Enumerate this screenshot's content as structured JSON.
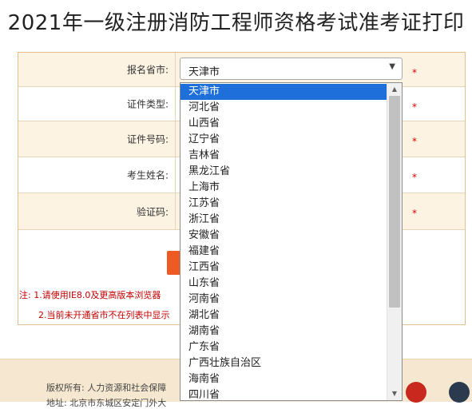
{
  "page_title": "2021年一级注册消防工程师资格考试准考证打印",
  "form": {
    "fields": [
      {
        "label": "报名省市:",
        "required": "*"
      },
      {
        "label": "证件类型:",
        "required": "*"
      },
      {
        "label": "证件号码:",
        "required": "*"
      },
      {
        "label": "考生姓名:",
        "required": "*"
      },
      {
        "label": "验证码:",
        "required": "*"
      }
    ],
    "province_select": {
      "value": "天津市"
    }
  },
  "notes": {
    "line1": "注: 1.请使用IE8.0及更高版本浏览器",
    "line2": "2.当前未开通省市不在列表中显示"
  },
  "footer": {
    "copyright": "版权所有: 人力资源和社会保障",
    "address": "地址: 北京市东城区安定门外大"
  },
  "dropdown": {
    "options": [
      "天津市",
      "河北省",
      "山西省",
      "辽宁省",
      "吉林省",
      "黑龙江省",
      "上海市",
      "江苏省",
      "浙江省",
      "安徽省",
      "福建省",
      "江西省",
      "山东省",
      "河南省",
      "湖北省",
      "湖南省",
      "广东省",
      "广西壮族自治区",
      "海南省",
      "四川省"
    ],
    "selected_index": 0
  },
  "colors": {
    "selected": "#1e6fd9",
    "required": "#d40000",
    "accent": "#ee5a24",
    "row_alt": "#fcf3e3"
  }
}
